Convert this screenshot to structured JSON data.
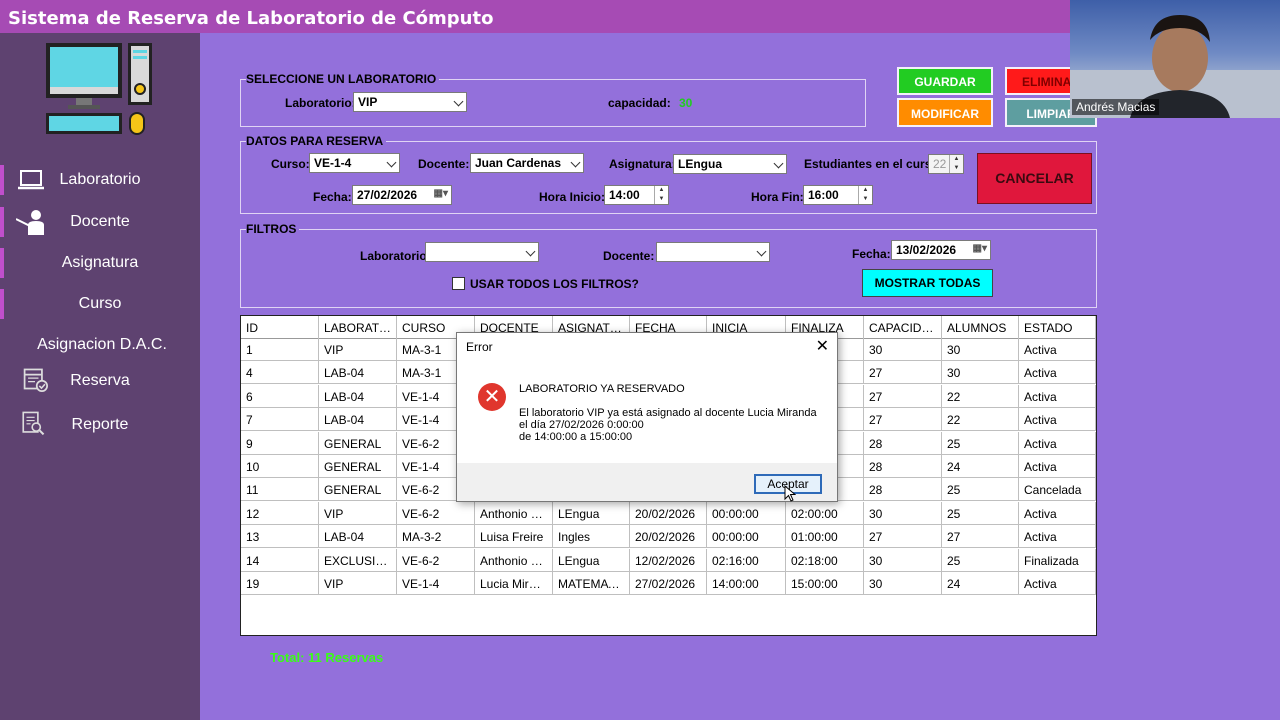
{
  "app": {
    "title": "Sistema de Reserva de Laboratorio de Cómputo"
  },
  "colors": {
    "titlebar": "#A64BB4",
    "sidebar": "#5E4270",
    "main": "#9370DB",
    "guardar": "#22CC22",
    "eliminar": "#FF1A1A",
    "modificar": "#FF8C00",
    "limpiar": "#5E9EA0",
    "cancelar": "#E0173C",
    "mostrar": "#00FFFF",
    "total": "#39FF14"
  },
  "sidebar": {
    "logo_icon": "computer-workstation-icon",
    "items": [
      {
        "label": "Laboratorio",
        "icon": "laptop-icon"
      },
      {
        "label": "Docente",
        "icon": "teacher-icon"
      },
      {
        "label": "Asignatura"
      },
      {
        "label": "Curso"
      },
      {
        "label": "Asignacion D.A.C."
      },
      {
        "label": "Reserva",
        "icon": "calendar-check-icon"
      },
      {
        "label": "Reporte",
        "icon": "report-search-icon"
      }
    ]
  },
  "lab_group": {
    "title": "SELECCIONE UN LABORATORIO",
    "lab_label": "Laboratorio:",
    "lab_value": "VIP",
    "cap_label": "capacidad:",
    "cap_value": "30"
  },
  "buttons": {
    "guardar": "GUARDAR",
    "eliminar": "ELIMINAR",
    "modificar": "MODIFICAR",
    "limpiar": "LIMPIAR",
    "cancelar": "CANCELAR",
    "mostrar": "MOSTRAR TODAS"
  },
  "reserva_group": {
    "title": "DATOS PARA RESERVA",
    "curso_label": "Curso:",
    "curso_value": "VE-1-4",
    "docente_label": "Docente:",
    "docente_value": "Juan Cardenas",
    "asignatura_label": "Asignatura:",
    "asignatura_value": "LEngua",
    "estudiantes_label": "Estudiantes en el curso:",
    "estudiantes_value": "22",
    "fecha_label": "Fecha:",
    "fecha_value": "27/02/2026",
    "hora_inicio_label": "Hora Inicio:",
    "hora_inicio_value": "14:00",
    "hora_fin_label": "Hora Fin:",
    "hora_fin_value": "16:00"
  },
  "filtros_group": {
    "title": "FILTROS",
    "lab_label": "Laboratorio:",
    "lab_value": "",
    "docente_label": "Docente:",
    "docente_value": "",
    "fecha_label": "Fecha:",
    "fecha_value": "13/02/2026",
    "check_label": "USAR TODOS LOS FILTROS?"
  },
  "table": {
    "headers": [
      "ID",
      "LABORATORIO",
      "CURSO",
      "DOCENTE",
      "ASIGNATURA",
      "FECHA",
      "INICIA",
      "FINALIZA",
      "CAPACIDAD",
      "ALUMNOS",
      "ESTADO"
    ],
    "rows": [
      [
        "1",
        "VIP",
        "MA-3-1",
        "",
        "",
        "",
        "",
        "",
        "30",
        "30",
        "Activa"
      ],
      [
        "4",
        "LAB-04",
        "MA-3-1",
        "",
        "",
        "",
        "",
        "",
        "27",
        "30",
        "Activa"
      ],
      [
        "6",
        "LAB-04",
        "VE-1-4",
        "",
        "",
        "",
        "",
        "",
        "27",
        "22",
        "Activa"
      ],
      [
        "7",
        "LAB-04",
        "VE-1-4",
        "",
        "",
        "",
        "",
        "",
        "27",
        "22",
        "Activa"
      ],
      [
        "9",
        "GENERAL",
        "VE-6-2",
        "",
        "",
        "",
        "",
        "",
        "28",
        "25",
        "Activa"
      ],
      [
        "10",
        "GENERAL",
        "VE-1-4",
        "",
        "",
        "",
        "",
        "",
        "28",
        "24",
        "Activa"
      ],
      [
        "11",
        "GENERAL",
        "VE-6-2",
        "",
        "",
        "",
        "",
        "",
        "28",
        "25",
        "Cancelada"
      ],
      [
        "12",
        "VIP",
        "VE-6-2",
        "Anthonio M...",
        "LEngua",
        "20/02/2026",
        "00:00:00",
        "02:00:00",
        "30",
        "25",
        "Activa"
      ],
      [
        "13",
        "LAB-04",
        "MA-3-2",
        "Luisa Freire",
        "Ingles",
        "20/02/2026",
        "00:00:00",
        "01:00:00",
        "27",
        "27",
        "Activa"
      ],
      [
        "14",
        "EXCLUSIVO",
        "VE-6-2",
        "Anthonio M...",
        "LEngua",
        "12/02/2026",
        "02:16:00",
        "02:18:00",
        "30",
        "25",
        "Finalizada"
      ],
      [
        "19",
        "VIP",
        "VE-1-4",
        "Lucia Miranda",
        "MATEMATIC...",
        "27/02/2026",
        "14:00:00",
        "15:00:00",
        "30",
        "24",
        "Activa"
      ]
    ]
  },
  "total": "Total: 11 Reservas",
  "dialog": {
    "title": "Error",
    "icon": "error-x-icon",
    "heading": "LABORATORIO YA RESERVADO",
    "line1": "El laboratorio VIP ya está asignado al docente Lucia Miranda",
    "line2": "el día 27/02/2026 0:00:00",
    "line3": "de 14:00:00 a 15:00:00",
    "ok": "Aceptar"
  },
  "webcam": {
    "name": "Andrés Macias"
  }
}
